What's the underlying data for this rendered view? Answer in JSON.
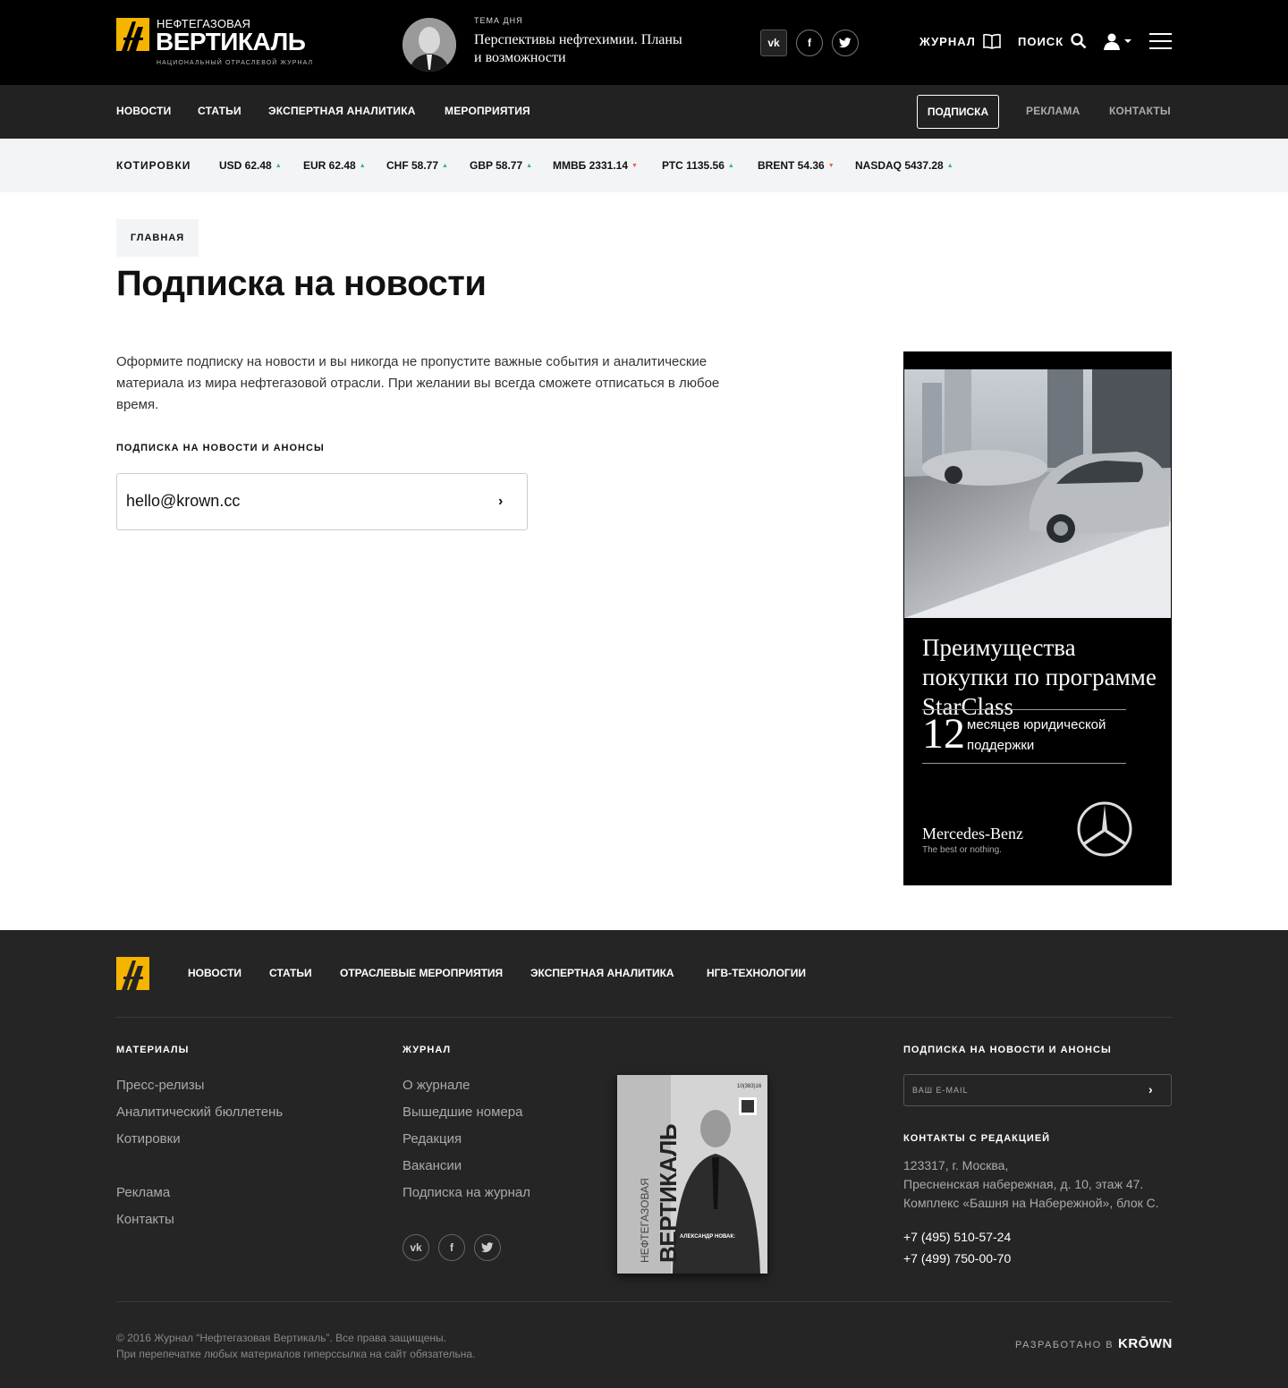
{
  "header": {
    "logo": {
      "top": "НЕФТЕГАЗОВАЯ",
      "main": "ВЕРТИКАЛЬ",
      "sub": "НАЦИОНАЛЬНЫЙ ОТРАСЛЕВОЙ ЖУРНАЛ"
    },
    "theme": {
      "label": "ТЕМА ДНЯ",
      "title": "Перспективы нефтехимии. Планы и возможности"
    },
    "social": [
      "vk-icon",
      "facebook-icon",
      "twitter-icon"
    ],
    "journal_label": "ЖУРНАЛ",
    "search_label": "ПОИСК"
  },
  "nav": {
    "items": [
      "НОВОСТИ",
      "СТАТЬИ",
      "ЭКСПЕРТНАЯ АНАЛИТИКА",
      "МЕРОПРИЯТИЯ"
    ],
    "subscribe": "ПОДПИСКА",
    "ads": "РЕКЛАМА",
    "contacts": "КОНТАКТЫ"
  },
  "quotes": {
    "label": "КОТИРОВКИ",
    "items": [
      {
        "text": "USD 62.48",
        "trend": "up"
      },
      {
        "text": "EUR 62.48",
        "trend": "up"
      },
      {
        "text": "CHF 58.77",
        "trend": "up"
      },
      {
        "text": "GBP 58.77",
        "trend": "up"
      },
      {
        "text": "ММВБ 2331.14",
        "trend": "down"
      },
      {
        "text": "РТС 1135.56",
        "trend": "up"
      },
      {
        "text": "BRENT 54.36",
        "trend": "down"
      },
      {
        "text": "NASDAQ 5437.28",
        "trend": "up"
      }
    ],
    "up_color": "#2fb57a",
    "down_color": "#e0623c"
  },
  "main": {
    "breadcrumb": "ГЛАВНАЯ",
    "title": "Подписка на новости",
    "intro": "Оформите подписку на новости и вы никогда не пропустите важные события и аналитические материала из мира нефтегазовой отрасли. При желании вы всегда сможете отписаться в любое время.",
    "form_label": "ПОДПИСКА НА НОВОСТИ И АНОНСЫ",
    "email_value": "hello@krown.cc"
  },
  "ad": {
    "headline": "Преимущества покупки по программе StarClass",
    "number": "12",
    "number_text": "месяцев юридической поддержки",
    "brand": "Mercedes-Benz",
    "slogan": "The best or nothing."
  },
  "footer": {
    "nav": [
      "НОВОСТИ",
      "СТАТЬИ",
      "ОТРАСЛЕВЫЕ МЕРОПРИЯТИЯ",
      "ЭКСПЕРТНАЯ АНАЛИТИКА",
      "НГВ-ТЕХНОЛОГИИ"
    ],
    "materials": {
      "title": "МАТЕРИАЛЫ",
      "links": [
        "Пресс-релизы",
        "Аналитический бюллетень",
        "Котировки",
        "Реклама",
        "Контакты"
      ]
    },
    "journal": {
      "title": "ЖУРНАЛ",
      "links": [
        "О журнале",
        "Вышедшие номера",
        "Редакция",
        "Вакансии",
        "Подписка на журнал"
      ]
    },
    "cover": {
      "title": "ВЕРТИКАЛЬ",
      "subtitle": "НЕФТЕГАЗОВАЯ",
      "issue": "10(383)16",
      "person": "АЛЕКСАНДР НОВАК:"
    },
    "subscribe": {
      "title": "ПОДПИСКА НА НОВОСТИ И АНОНСЫ",
      "placeholder": "ВАШ E-MAIL"
    },
    "contacts": {
      "title": "КОНТАКТЫ С РЕДАКЦИЕЙ",
      "address": [
        "123317, г. Москва,",
        "Пресненская набережная, д. 10, этаж 47.",
        "Комплекс «Башня на Набережной», блок С."
      ],
      "phones": [
        "+7 (495) 510-57-24",
        "+7 (499) 750-00-70"
      ]
    },
    "copyright": [
      "© 2016 Журнал “Нефтегазовая Вертикаль”. Все права защищены.",
      "При перепечатке любых материалов гиперссылка на сайт обязательна."
    ],
    "developed_by": "РАЗРАБОТАНО В",
    "developer": "KRŌWN"
  }
}
